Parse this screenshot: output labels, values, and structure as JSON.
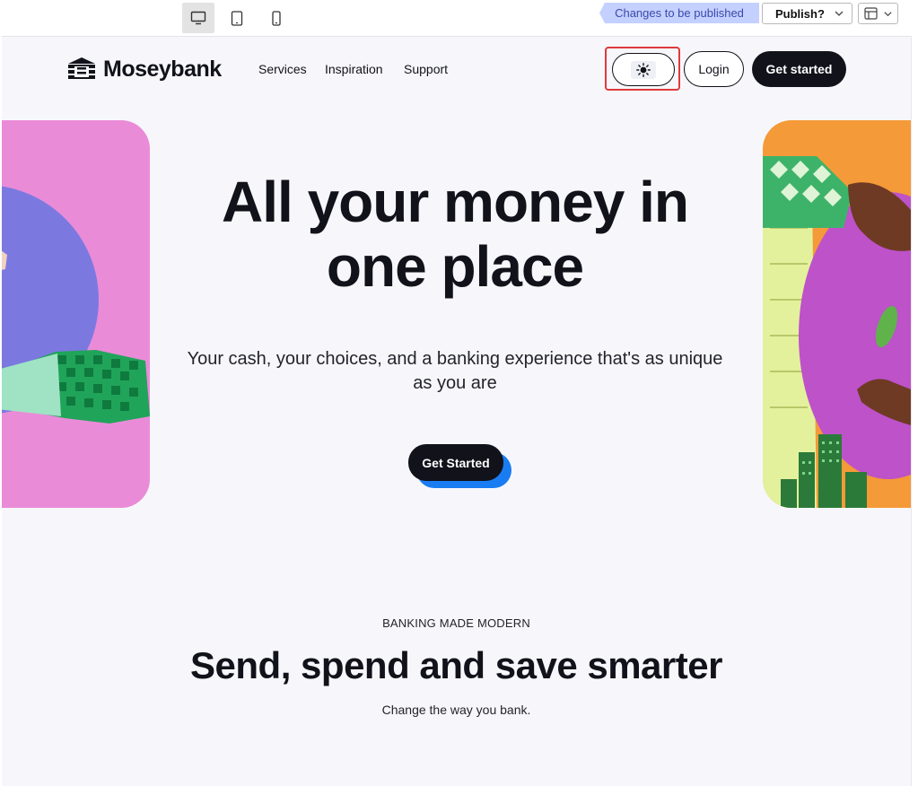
{
  "editor": {
    "status_tag": "Changes to be published",
    "publish_label": "Publish?",
    "devices": [
      {
        "name": "desktop",
        "icon": "desktop-icon",
        "active": true
      },
      {
        "name": "tablet",
        "icon": "tablet-icon",
        "active": false
      },
      {
        "name": "mobile",
        "icon": "mobile-icon",
        "active": false
      }
    ]
  },
  "site": {
    "brand": "Moseybank",
    "nav": [
      "Services",
      "Inspiration",
      "Support"
    ],
    "theme_toggle_icon": "sun-icon",
    "login_label": "Login",
    "get_started_label": "Get started"
  },
  "hero": {
    "title": "All your money in one place",
    "subtitle": "Your cash, your choices, and a banking experience that's as unique as you are",
    "cta_label": "Get Started"
  },
  "section": {
    "eyebrow": "BANKING MADE MODERN",
    "title": "Send, spend and save smarter",
    "subtitle": "Change the way you bank."
  },
  "colors": {
    "ink": "#11121a",
    "accent_blue": "#1a7cf2",
    "page_bg": "#f7f7fb",
    "highlight_red": "#e0393c",
    "status_tag_bg": "#c4d0ff"
  }
}
